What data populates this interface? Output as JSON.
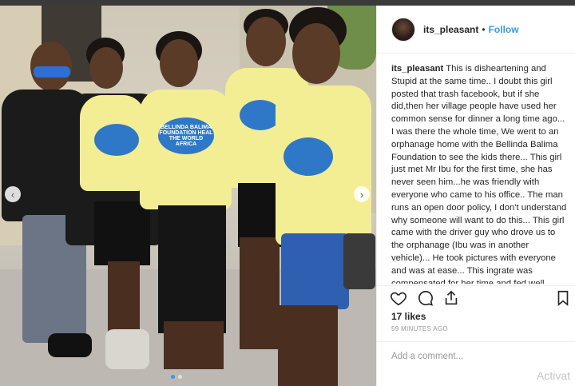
{
  "post": {
    "username": "its_pleasant",
    "separator": "•",
    "follow_label": "Follow",
    "caption_text": "This is disheartening and Stupid at the same time.. I doubt this girl posted that trash facebook, but if she did,then her village people have used her common sense for dinner a long time ago... I was there the whole time, We went to an orphanage home with the Bellinda Balima Foundation to see the kids there... This girl just met Mr Ibu for the first time, she has never seen him...he was friendly with everyone who came to his office.. The man runs an open door policy, I don't understand why someone will want to do this... This girl came with the driver guy who drove us to the orphanage (Ibu was in another vehicle)... He took pictures with everyone and was at ease... This ingrate was compensated for her time and fed well... Someone help me tell her, this is not the right way... I will not hide the truth. I will",
    "likes": "17 likes",
    "time_ago": "59 MINUTES AGO",
    "comment_placeholder": "Add a comment...",
    "watermark": "Activat"
  },
  "photo": {
    "badge_text": "BELLINDA BALIMA FOUNDATION HEAL THE WORLD AFRICA"
  },
  "icons": [
    "heart-icon",
    "comment-icon",
    "share-icon",
    "bookmark-icon",
    "chevron-left-icon",
    "chevron-right-icon"
  ],
  "colors": {
    "accent": "#3897f0",
    "shirt": "#f3ee93",
    "text": "#262626",
    "muted": "#999999"
  }
}
